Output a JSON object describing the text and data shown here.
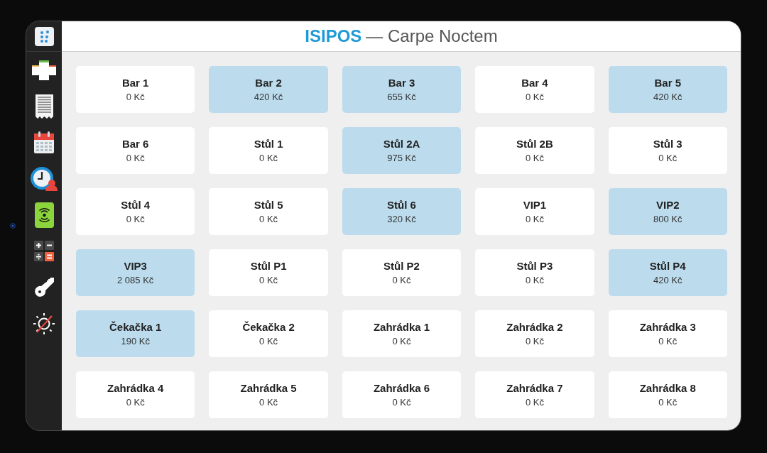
{
  "header": {
    "brand": "ISIPOS",
    "title": "— Carpe Noctem"
  },
  "tables": [
    {
      "name": "Bar 1",
      "total": "0 Kč",
      "occupied": false
    },
    {
      "name": "Bar 2",
      "total": "420 Kč",
      "occupied": true
    },
    {
      "name": "Bar 3",
      "total": "655 Kč",
      "occupied": true
    },
    {
      "name": "Bar 4",
      "total": "0 Kč",
      "occupied": false
    },
    {
      "name": "Bar 5",
      "total": "420 Kč",
      "occupied": true
    },
    {
      "name": "Bar 6",
      "total": "0 Kč",
      "occupied": false
    },
    {
      "name": "Stůl 1",
      "total": "0 Kč",
      "occupied": false
    },
    {
      "name": "Stůl 2A",
      "total": "975 Kč",
      "occupied": true
    },
    {
      "name": "Stůl 2B",
      "total": "0 Kč",
      "occupied": false
    },
    {
      "name": "Stůl 3",
      "total": "0 Kč",
      "occupied": false
    },
    {
      "name": "Stůl 4",
      "total": "0 Kč",
      "occupied": false
    },
    {
      "name": "Stůl 5",
      "total": "0 Kč",
      "occupied": false
    },
    {
      "name": "Stůl 6",
      "total": "320 Kč",
      "occupied": true
    },
    {
      "name": "VIP1",
      "total": "0 Kč",
      "occupied": false
    },
    {
      "name": "VIP2",
      "total": "800 Kč",
      "occupied": true
    },
    {
      "name": "VIP3",
      "total": "2 085 Kč",
      "occupied": true
    },
    {
      "name": "Stůl P1",
      "total": "0 Kč",
      "occupied": false
    },
    {
      "name": "Stůl P2",
      "total": "0 Kč",
      "occupied": false
    },
    {
      "name": "Stůl P3",
      "total": "0 Kč",
      "occupied": false
    },
    {
      "name": "Stůl P4",
      "total": "420 Kč",
      "occupied": true
    },
    {
      "name": "Čekačka 1",
      "total": "190 Kč",
      "occupied": true
    },
    {
      "name": "Čekačka 2",
      "total": "0 Kč",
      "occupied": false
    },
    {
      "name": "Zahrádka 1",
      "total": "0 Kč",
      "occupied": false
    },
    {
      "name": "Zahrádka 2",
      "total": "0 Kč",
      "occupied": false
    },
    {
      "name": "Zahrádka 3",
      "total": "0 Kč",
      "occupied": false
    },
    {
      "name": "Zahrádka 4",
      "total": "0 Kč",
      "occupied": false
    },
    {
      "name": "Zahrádka 5",
      "total": "0 Kč",
      "occupied": false
    },
    {
      "name": "Zahrádka 6",
      "total": "0 Kč",
      "occupied": false
    },
    {
      "name": "Zahrádka 7",
      "total": "0 Kč",
      "occupied": false
    },
    {
      "name": "Zahrádka 8",
      "total": "0 Kč",
      "occupied": false
    }
  ]
}
